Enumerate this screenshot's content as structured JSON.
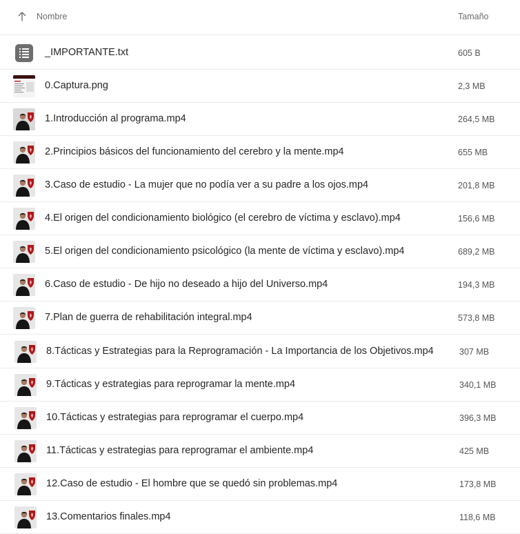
{
  "header": {
    "name_label": "Nombre",
    "size_label": "Tamaño",
    "sort_icon": "arrow-up-icon"
  },
  "files": [
    {
      "name": "_IMPORTANTE.txt",
      "size": "605 B",
      "kind": "text"
    },
    {
      "name": "0.Captura.png",
      "size": "2,3 MB",
      "kind": "image"
    },
    {
      "name": "1.Introducción al programa.mp4",
      "size": "264,5 MB",
      "kind": "video"
    },
    {
      "name": "2.Principios básicos del funcionamiento del cerebro y la mente.mp4",
      "size": "655 MB",
      "kind": "video"
    },
    {
      "name": "3.Caso de estudio - La mujer que no podía ver a su padre a los ojos.mp4",
      "size": "201,8 MB",
      "kind": "video"
    },
    {
      "name": "4.El origen del condicionamiento biológico (el cerebro de víctima y esclavo).mp4",
      "size": "156,6 MB",
      "kind": "video"
    },
    {
      "name": "5.El origen del condicionamiento psicológico (la mente de víctima y esclavo).mp4",
      "size": "689,2 MB",
      "kind": "video"
    },
    {
      "name": "6.Caso de estudio - De hijo no deseado a hijo del Universo.mp4",
      "size": "194,3 MB",
      "kind": "video"
    },
    {
      "name": "7.Plan de guerra de rehabilitación integral.mp4",
      "size": "573,8 MB",
      "kind": "video"
    },
    {
      "name": "8.Tácticas y Estrategias para la Reprogramación - La Importancia de los Objetivos.mp4",
      "size": "307 MB",
      "kind": "video"
    },
    {
      "name": "9.Tácticas y estrategias para reprogramar la mente.mp4",
      "size": "340,1 MB",
      "kind": "video"
    },
    {
      "name": "10.Tácticas y estrategias para reprogramar el cuerpo.mp4",
      "size": "396,3 MB",
      "kind": "video"
    },
    {
      "name": "11.Tácticas y estrategias para reprogramar el ambiente.mp4",
      "size": "425 MB",
      "kind": "video"
    },
    {
      "name": "12.Caso de estudio - El hombre que se quedó sin problemas.mp4",
      "size": "173,8 MB",
      "kind": "video"
    },
    {
      "name": "13.Comentarios finales.mp4",
      "size": "118,6 MB",
      "kind": "video"
    }
  ]
}
